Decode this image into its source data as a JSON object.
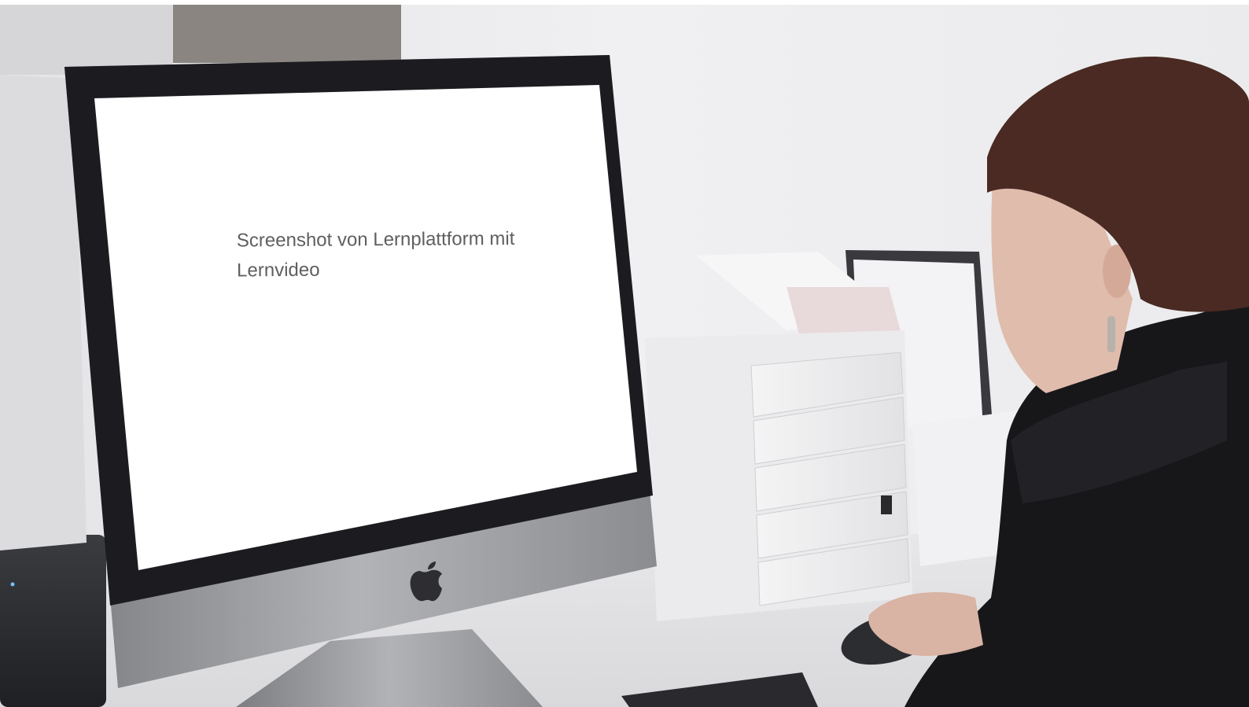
{
  "screen": {
    "text_line1": "Screenshot von Lernplattform mit",
    "text_line2": "Lernvideo"
  },
  "colors": {
    "wall": "#ececee",
    "desk": "#e6e6e8",
    "bezel": "#1c1c20",
    "aluminum": "#9a9ca0",
    "sweater": "#1a1a1a",
    "hair": "#4a2a22",
    "skin": "#d9b3a3"
  },
  "icons": [
    "apple-logo-icon"
  ]
}
